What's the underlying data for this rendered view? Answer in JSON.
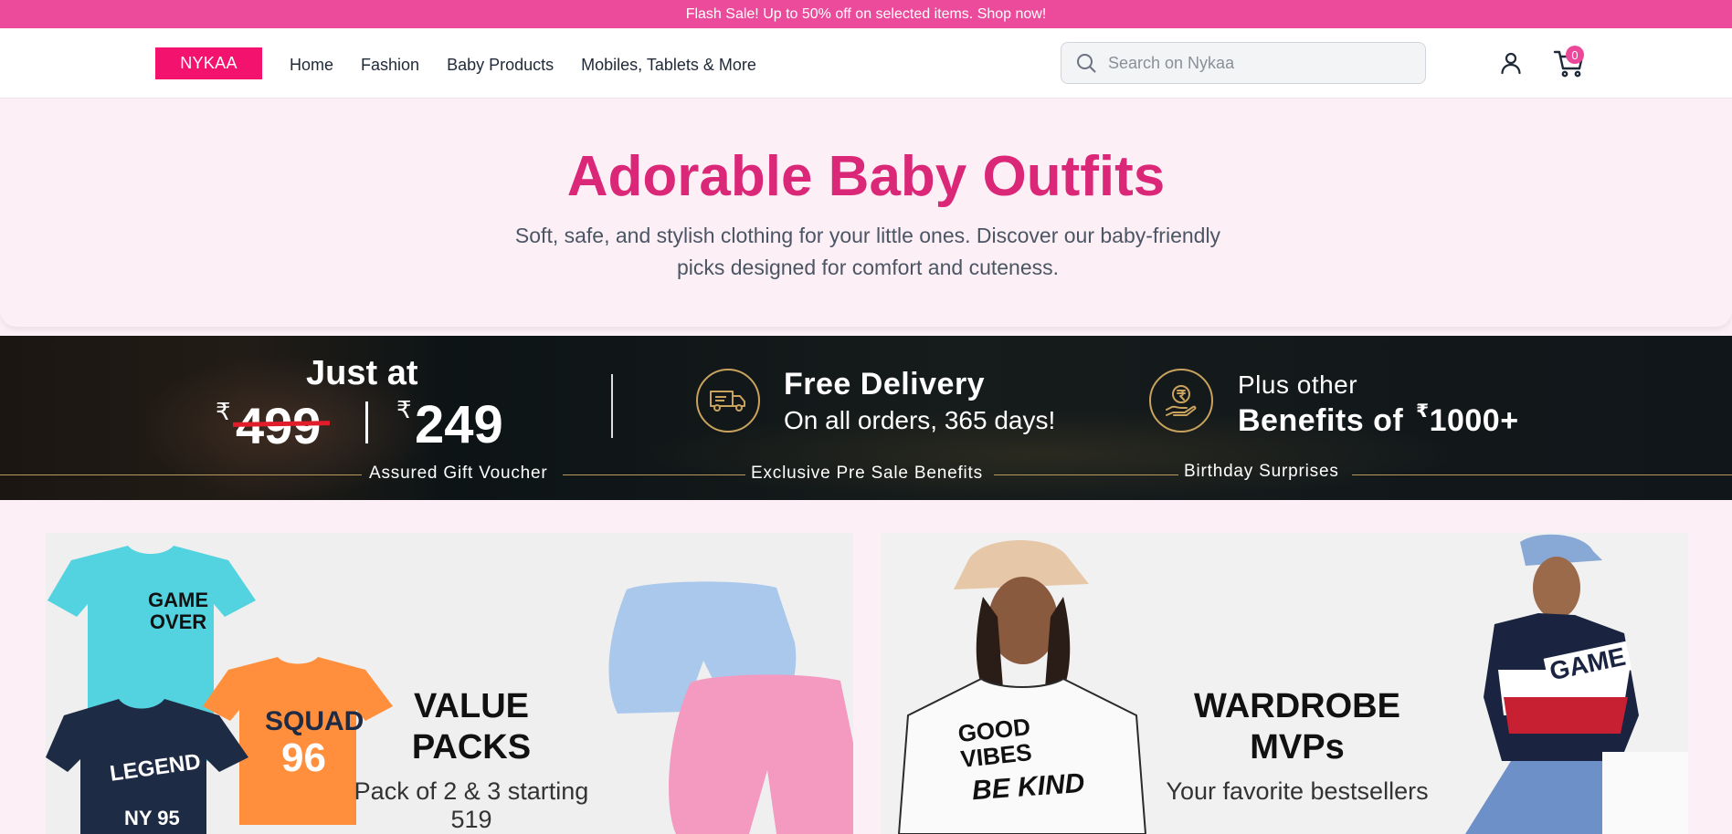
{
  "flash_banner": "Flash Sale! Up to 50% off on selected items. Shop now!",
  "header": {
    "logo": "NYKAA",
    "nav": [
      "Home",
      "Fashion",
      "Baby Products",
      "Mobiles, Tablets & More"
    ],
    "search_placeholder": "Search on Nykaa",
    "cart_count": "0"
  },
  "hero": {
    "title": "Adorable Baby Outfits",
    "subtitle": "Soft, safe, and stylish clothing for your little ones. Discover our baby-friendly picks designed for comfort and cuteness."
  },
  "promo": {
    "just_at": "Just at",
    "currency": "₹",
    "old_price": "499",
    "new_price": "249",
    "free_delivery_title": "Free Delivery",
    "free_delivery_sub": "On all orders, 365 days!",
    "plus_other": "Plus other",
    "benefits_prefix": "Benefits of",
    "benefits_amount": "1000+",
    "labels": [
      "Assured Gift Voucher",
      "Exclusive Pre Sale Benefits",
      "Birthday Surprises"
    ]
  },
  "cards": [
    {
      "title_line1": "VALUE",
      "title_line2": "PACKS",
      "subtitle": "Pack of 2 & 3 starting 519",
      "tshirt_texts": [
        "GAME",
        "OVER",
        "SQUAD",
        "96",
        "LEGEND",
        "NY 95"
      ]
    },
    {
      "title_line1": "WARDROBE",
      "title_line2": "MVPs",
      "subtitle": "Your favorite bestsellers",
      "tshirt_texts": [
        "GOOD",
        "VIBES",
        "BE KIND",
        "GAME"
      ]
    }
  ],
  "colors": {
    "brand_pink": "#f4126f",
    "flash_pink": "#ec4b9c",
    "hero_title": "#db2777",
    "gold": "#c9a35e"
  }
}
